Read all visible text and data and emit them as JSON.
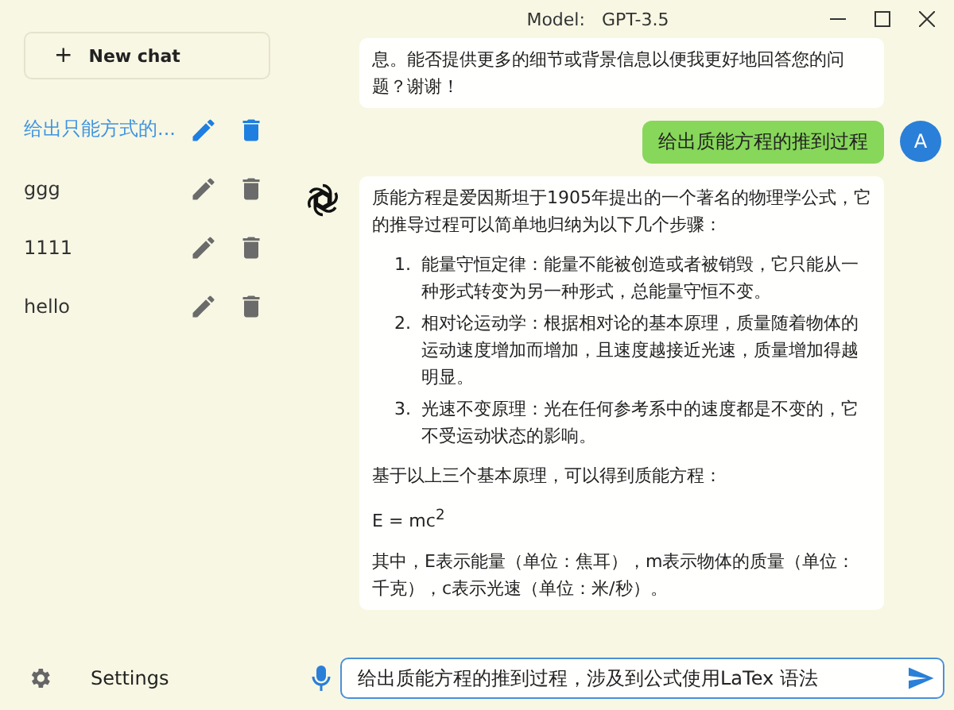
{
  "window": {
    "title_label": "Model:",
    "title_value": "GPT-3.5"
  },
  "sidebar": {
    "new_chat": {
      "icon": "+",
      "label": "New chat"
    },
    "items": [
      {
        "label": "给出只能方式的...",
        "selected": true
      },
      {
        "label": "ggg",
        "selected": false
      },
      {
        "label": "1111",
        "selected": false
      },
      {
        "label": "hello",
        "selected": false
      }
    ],
    "settings": "Settings"
  },
  "messages": [
    {
      "kind": "assistant",
      "paragraphs": [
        {
          "kind": "text",
          "text": "息。能否提供更多的细节或背景信息以便我更好地回答您的问题？谢谢！"
        }
      ]
    },
    {
      "kind": "user",
      "avatar": "A",
      "text": "给出质能方程的推到过程"
    },
    {
      "kind": "assistant",
      "paragraphs": [
        {
          "kind": "text",
          "text": "质能方程是爱因斯坦于1905年提出的一个著名的物理学公式，它的推导过程可以简单地归纳为以下几个步骤："
        },
        {
          "kind": "list",
          "items": [
            {
              "marker": "1.",
              "text": "能量守恒定律：能量不能被创造或者被销毁，它只能从一种形式转变为另一种形式，总能量守恒不变。"
            },
            {
              "marker": "2.",
              "text": "相对论运动学：根据相对论的基本原理，质量随着物体的运动速度增加而增加，且速度越接近光速，质量增加得越明显。"
            },
            {
              "marker": "3.",
              "text": "光速不变原理：光在任何参考系中的速度都是不变的，它不受运动状态的影响。"
            }
          ]
        },
        {
          "kind": "text",
          "text": "基于以上三个基本原理，可以得到质能方程："
        },
        {
          "kind": "text",
          "text": "E = mc$^{2}$"
        },
        {
          "kind": "text",
          "text": "其中，E表示能量（单位：焦耳），m表示物体的质量（单位：千克），c表示光速（单位：米/秒）。"
        }
      ]
    }
  ],
  "input": {
    "value": "给出质能方程的推到过程，涉及到公式使用LaTex 语法"
  }
}
